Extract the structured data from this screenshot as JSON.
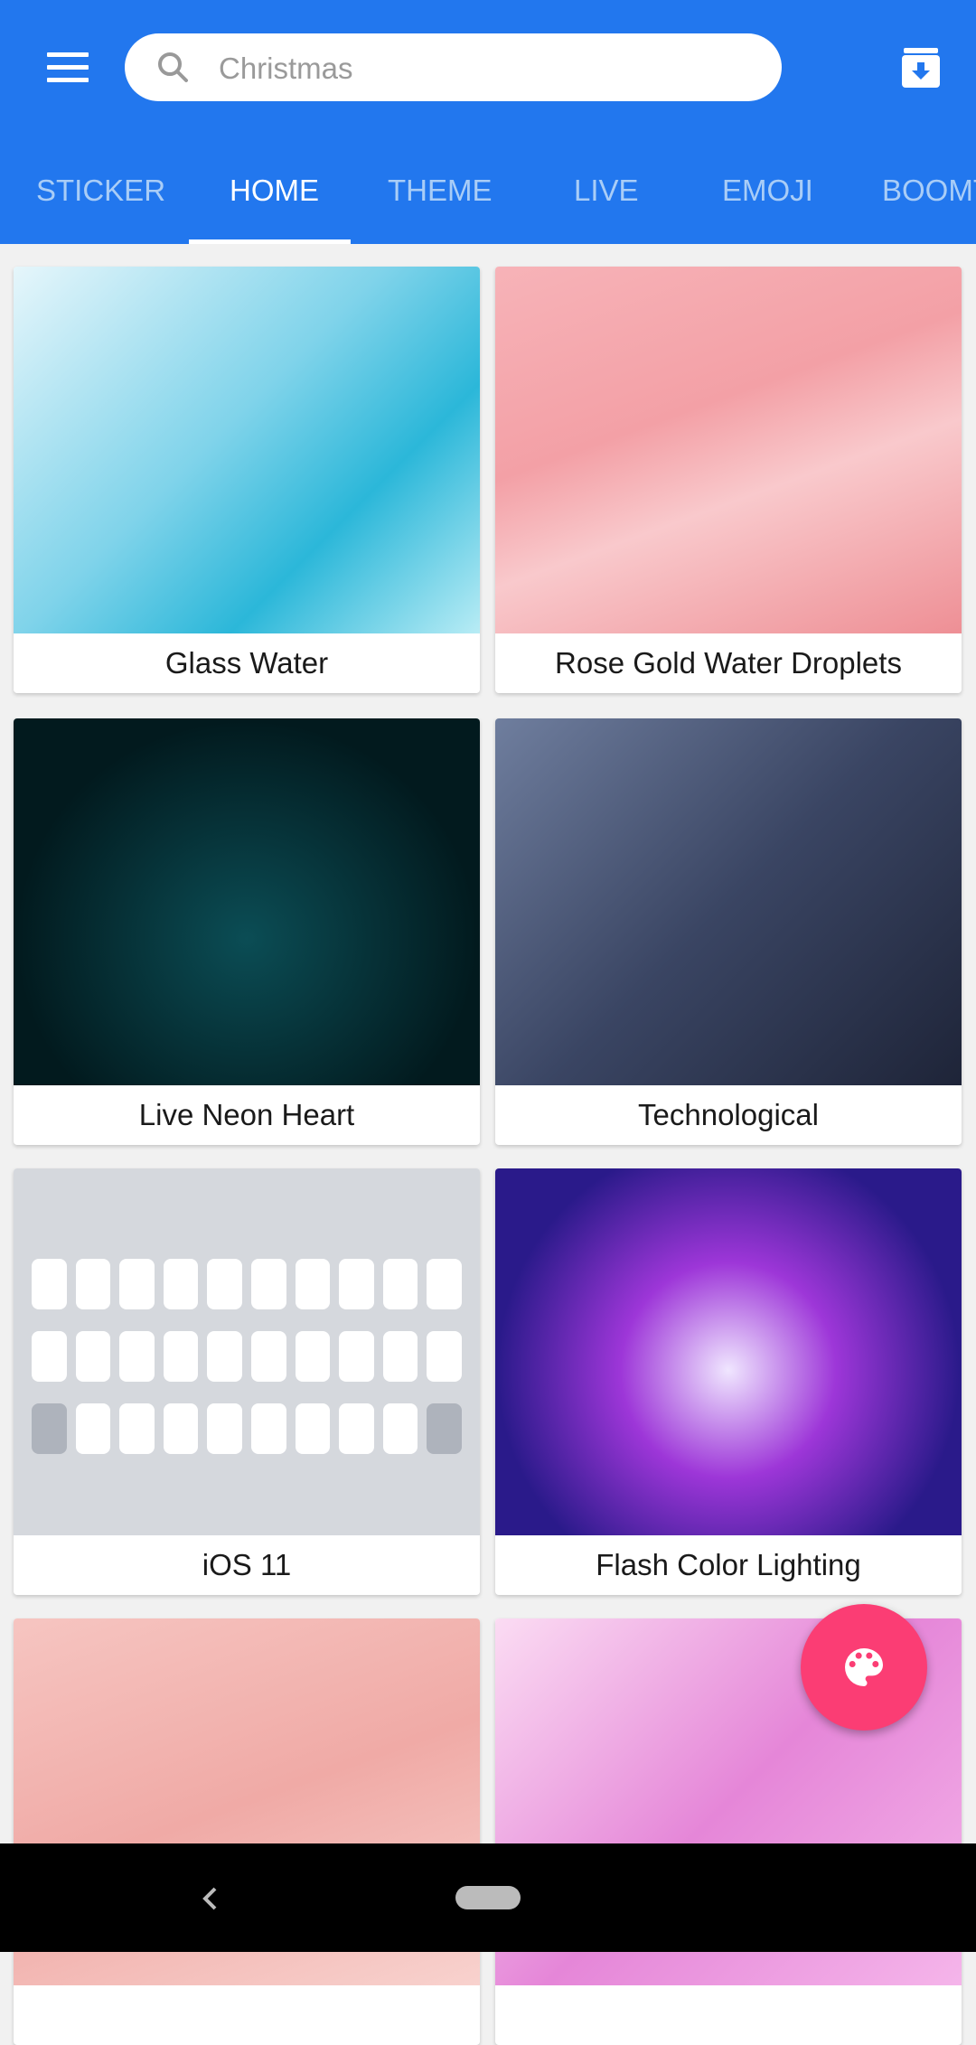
{
  "header": {
    "search": {
      "placeholder": "Christmas"
    },
    "tabs": [
      {
        "label": "STICKER"
      },
      {
        "label": "HOME",
        "active": true
      },
      {
        "label": "THEME"
      },
      {
        "label": "LIVE"
      },
      {
        "label": "EMOJI"
      },
      {
        "label": "BOOMT"
      }
    ]
  },
  "colors": {
    "brand": "#2277ee",
    "fab": "#fb3d74"
  },
  "themes": [
    {
      "title": "Glass Water"
    },
    {
      "title": "Rose Gold Water Droplets"
    },
    {
      "title": "Live Neon Heart"
    },
    {
      "title": "Technological"
    },
    {
      "title": "iOS 11"
    },
    {
      "title": "Flash Color Lighting"
    },
    {
      "title": ""
    },
    {
      "title": ""
    }
  ],
  "fab": {
    "icon": "palette-icon"
  },
  "navbar": {
    "icons": [
      "back-icon",
      "home-pill-icon"
    ]
  }
}
